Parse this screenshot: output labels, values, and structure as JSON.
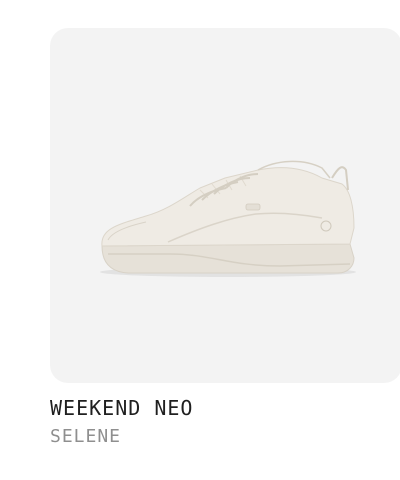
{
  "product": {
    "name": "WEEKEND NEO",
    "variant": "SELENE",
    "image_subject": "sneaker-icon",
    "colors": {
      "card_background": "#f3f3f3",
      "shoe": "#ebe7df",
      "name_text": "#1f1f1f",
      "variant_text": "#8f8f8f"
    }
  }
}
